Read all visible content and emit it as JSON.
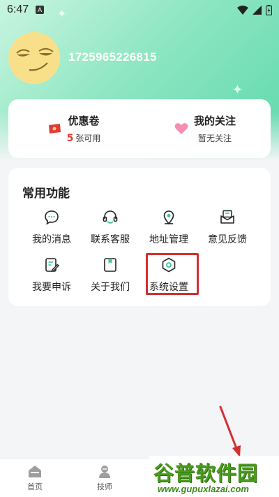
{
  "status_bar": {
    "time": "6:47",
    "notification_glyph": "A"
  },
  "profile": {
    "user_id": "1725965226815"
  },
  "stats": {
    "coupon": {
      "title": "优惠卷",
      "count": "5",
      "count_suffix": "张可用"
    },
    "follow": {
      "title": "我的关注",
      "subtitle": "暂无关注"
    }
  },
  "functions": {
    "title": "常用功能",
    "items": [
      {
        "label": "我的消息",
        "icon": "message-icon"
      },
      {
        "label": "联系客服",
        "icon": "headset-icon"
      },
      {
        "label": "地址管理",
        "icon": "location-pin-icon"
      },
      {
        "label": "意见反馈",
        "icon": "feedback-envelope-icon"
      },
      {
        "label": "我要申诉",
        "icon": "appeal-edit-icon"
      },
      {
        "label": "关于我们",
        "icon": "about-book-icon"
      },
      {
        "label": "系统设置",
        "icon": "settings-hexagon-icon"
      }
    ]
  },
  "bottom_nav": {
    "items": [
      {
        "label": "首页",
        "icon": "home-icon"
      },
      {
        "label": "技师",
        "icon": "technician-icon"
      }
    ]
  },
  "watermark": {
    "main": "谷普软件园",
    "sub": "www.gupuxlazai.com"
  },
  "colors": {
    "accent": "#3cc98f",
    "highlight": "#d32f2f",
    "coupon_count": "#e53935"
  }
}
